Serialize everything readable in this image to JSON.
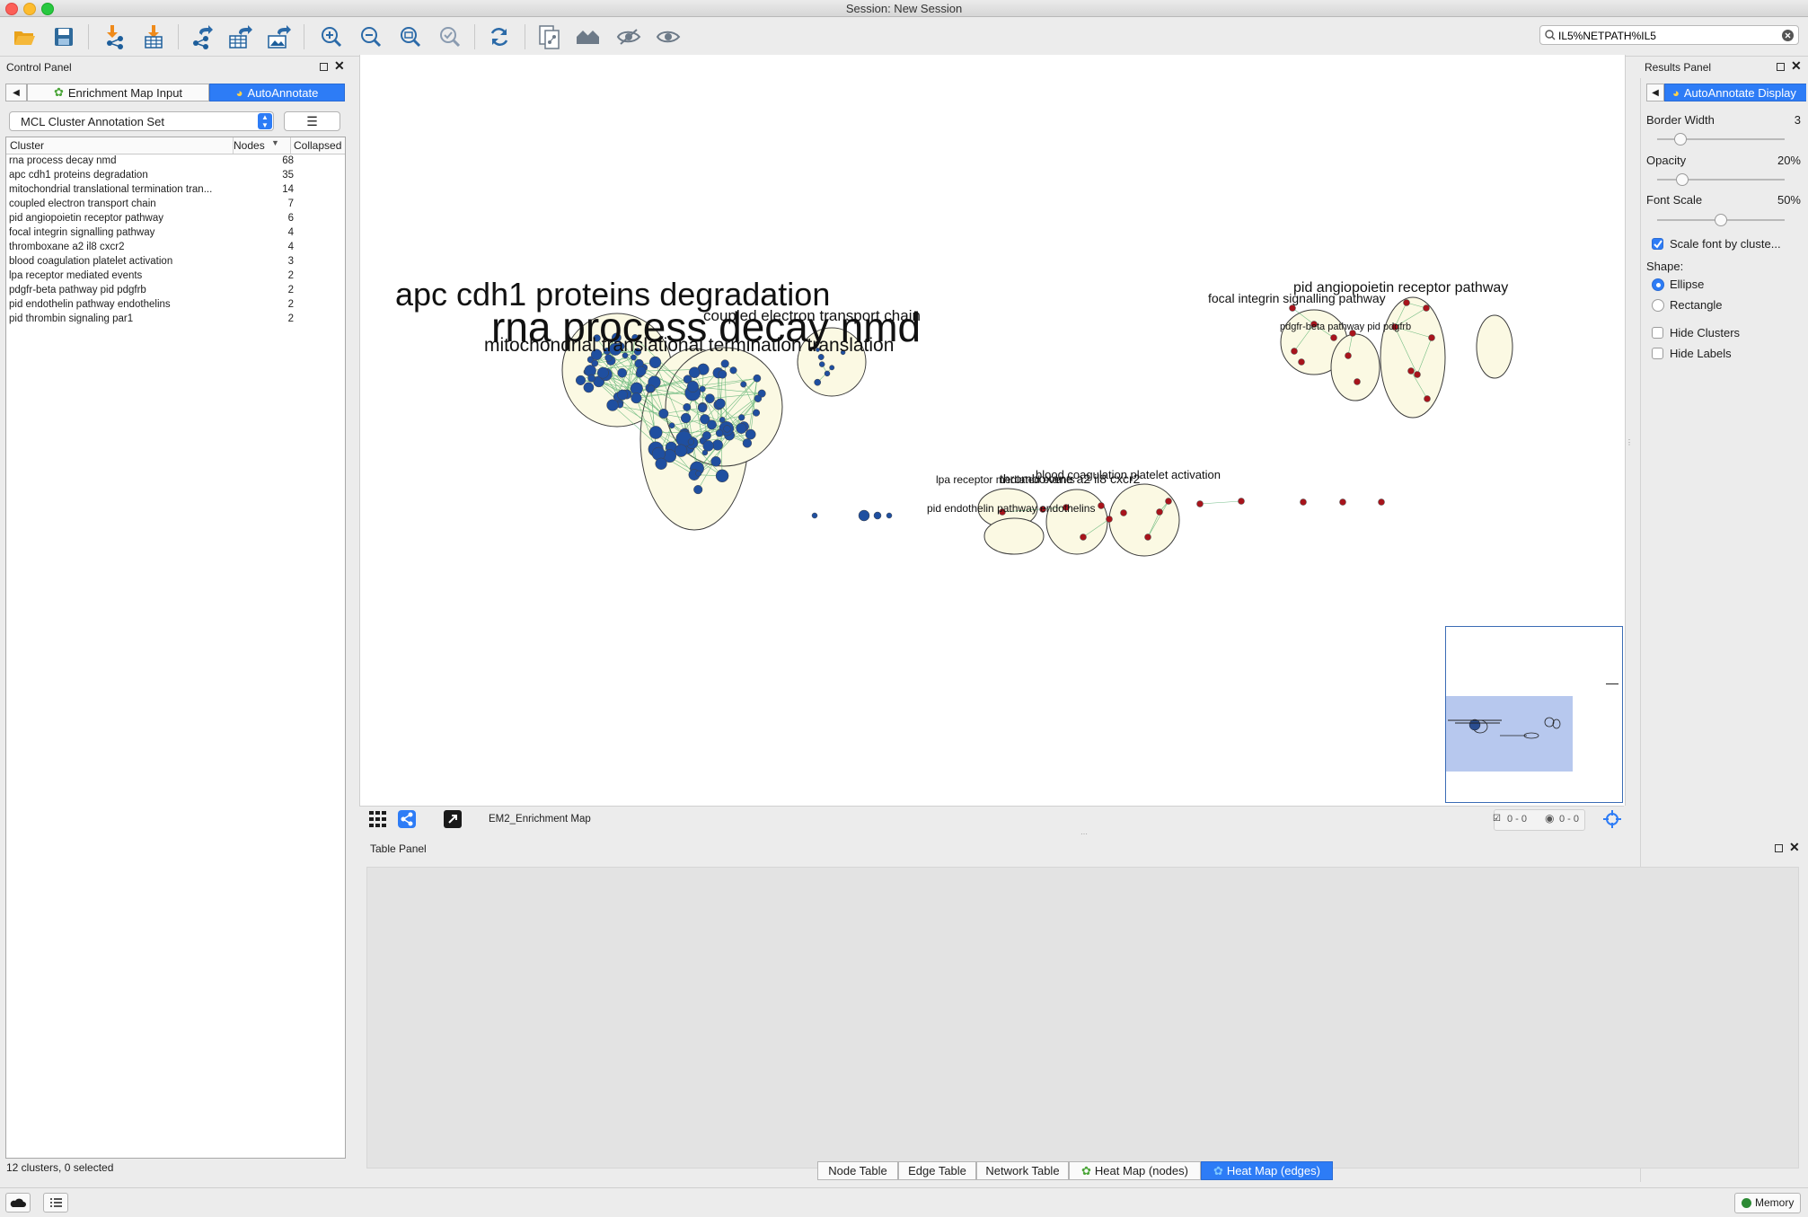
{
  "window": {
    "title": "Session: New Session"
  },
  "toolbar": {
    "search_value": "IL5%NETPATH%IL5"
  },
  "control_panel": {
    "title": "Control Panel",
    "tabs": [
      {
        "label": "Enrichment Map Input"
      },
      {
        "label": "AutoAnnotate"
      }
    ],
    "annotation_set": "MCL Cluster Annotation Set",
    "columns": [
      "Cluster",
      "Nodes",
      "Collapsed"
    ],
    "rows": [
      {
        "cluster": "rna process decay nmd",
        "nodes": "68"
      },
      {
        "cluster": "apc cdh1 proteins degradation",
        "nodes": "35"
      },
      {
        "cluster": "mitochondrial translational termination tran...",
        "nodes": "14"
      },
      {
        "cluster": "coupled electron transport chain",
        "nodes": "7"
      },
      {
        "cluster": "pid angiopoietin receptor pathway",
        "nodes": "6"
      },
      {
        "cluster": "focal integrin signalling pathway",
        "nodes": "4"
      },
      {
        "cluster": "thromboxane a2 il8 cxcr2",
        "nodes": "4"
      },
      {
        "cluster": "blood coagulation platelet activation",
        "nodes": "3"
      },
      {
        "cluster": "lpa receptor mediated events",
        "nodes": "2"
      },
      {
        "cluster": "pdgfr-beta pathway pid pdgfrb",
        "nodes": "2"
      },
      {
        "cluster": "pid endothelin pathway endothelins",
        "nodes": "2"
      },
      {
        "cluster": "pid thrombin signaling par1",
        "nodes": "2"
      }
    ],
    "footer": "12 clusters, 0 selected"
  },
  "network": {
    "name": "EM2_Enrichment Map",
    "sel_nodes": "0 - 0",
    "hidden": "0 - 0",
    "labels": {
      "l1": "apc cdh1 proteins degradation",
      "l2": "rna process decay nmd",
      "l3": "coupled electron transport chain",
      "l4": "mitochondrial translational termination translation",
      "l5": "pid angiopoietin receptor pathway",
      "l6": "focal integrin signalling pathway",
      "l7": "pdgfr-beta pathway pid pdgfrb",
      "l8": "blood coagulation platelet activation",
      "l9": "lpa receptor mediated events",
      "l10": "thromboxane a2 il8 cxcr2",
      "l11": "pid endothelin pathway endothelins"
    },
    "colors": {
      "blue_node": "#1f4fa0",
      "red_node": "#a8141c",
      "cluster_fill": "#fbf9e3",
      "edge": "#3aa35a"
    }
  },
  "results_panel": {
    "title": "Results Panel",
    "tab": "AutoAnnotate Display",
    "border_width": {
      "label": "Border Width",
      "value": "3",
      "level": 0.18
    },
    "opacity": {
      "label": "Opacity",
      "value": "20%",
      "level": 0.2
    },
    "font_scale": {
      "label": "Font Scale",
      "value": "50%",
      "level": 0.5
    },
    "scale_font": "Scale font by cluste...",
    "shape_label": "Shape:",
    "shape_options": [
      "Ellipse",
      "Rectangle"
    ],
    "hide_clusters": "Hide Clusters",
    "hide_labels": "Hide Labels"
  },
  "table_panel": {
    "title": "Table Panel",
    "tabs": [
      {
        "label": "Node Table"
      },
      {
        "label": "Edge Table"
      },
      {
        "label": "Network Table"
      },
      {
        "label": "Heat Map (nodes)"
      },
      {
        "label": "Heat Map (edges)"
      }
    ]
  },
  "status": {
    "memory": "Memory"
  }
}
